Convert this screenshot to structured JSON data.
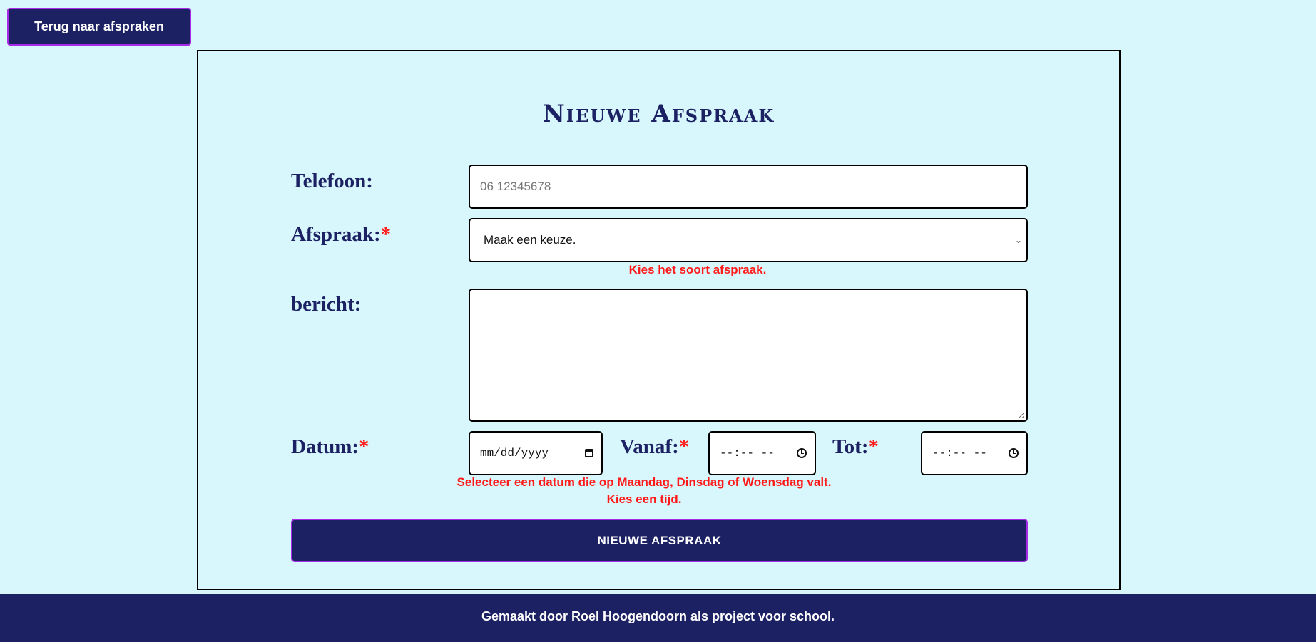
{
  "nav": {
    "back_label": "Terug naar afspraken"
  },
  "form": {
    "title": "Nieuwe Afspraak",
    "required_mark": "*",
    "phone": {
      "label": "Telefoon:",
      "placeholder": "06 12345678",
      "value": ""
    },
    "appointment": {
      "label": "Afspraak:",
      "selected": "Maak een keuze.",
      "error": "Kies het soort afspraak."
    },
    "message": {
      "label": "bericht:",
      "value": ""
    },
    "date": {
      "label": "Datum:",
      "placeholder": "mm/dd/yyyy",
      "error": "Selecteer een datum die op Maandag, Dinsdag of Woensdag valt."
    },
    "from": {
      "label": "Vanaf:",
      "placeholder": "--:-- --"
    },
    "to": {
      "label": "Tot:",
      "placeholder": "--:-- --"
    },
    "time_error": "Kies een tijd.",
    "submit_label": "NIEUWE AFSPRAAK"
  },
  "footer": {
    "text": "Gemaakt door Roel Hoogendoorn als project voor school."
  },
  "colors": {
    "background": "#d8f7fc",
    "navy": "#1c2163",
    "button_border": "#a62ae6",
    "error": "#ff1a1a"
  }
}
